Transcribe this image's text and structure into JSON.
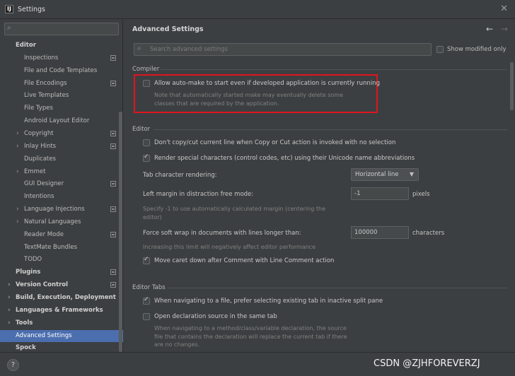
{
  "window": {
    "title": "Settings",
    "app_icon_text": "IJ"
  },
  "sidebar": {
    "search_placeholder": "",
    "items": [
      {
        "label": "Editor",
        "bold": true,
        "caret": "",
        "mark": false
      },
      {
        "label": "Inspections",
        "mark": true
      },
      {
        "label": "File and Code Templates",
        "mark": false
      },
      {
        "label": "File Encodings",
        "mark": true
      },
      {
        "label": "Live Templates",
        "mark": false
      },
      {
        "label": "File Types",
        "mark": false
      },
      {
        "label": "Android Layout Editor",
        "mark": false
      },
      {
        "label": "Copyright",
        "caret": ">",
        "mark": true
      },
      {
        "label": "Inlay Hints",
        "caret": ">",
        "mark": true
      },
      {
        "label": "Duplicates",
        "mark": false
      },
      {
        "label": "Emmet",
        "caret": ">",
        "mark": false
      },
      {
        "label": "GUI Designer",
        "mark": true
      },
      {
        "label": "Intentions",
        "mark": false
      },
      {
        "label": "Language Injections",
        "caret": ">",
        "mark": true
      },
      {
        "label": "Natural Languages",
        "caret": ">",
        "mark": false
      },
      {
        "label": "Reader Mode",
        "mark": true
      },
      {
        "label": "TextMate Bundles",
        "mark": false
      },
      {
        "label": "TODO",
        "mark": false
      },
      {
        "label": "Plugins",
        "bold": true,
        "mark": true
      },
      {
        "label": "Version Control",
        "bold": true,
        "caret": ">",
        "mark": true
      },
      {
        "label": "Build, Execution, Deployment",
        "bold": true,
        "caret": ">",
        "mark": false
      },
      {
        "label": "Languages & Frameworks",
        "bold": true,
        "caret": ">",
        "mark": false
      },
      {
        "label": "Tools",
        "bold": true,
        "caret": ">",
        "mark": false
      },
      {
        "label": "Advanced Settings",
        "bold": false,
        "selected": true,
        "mark": false
      },
      {
        "label": "Spock",
        "bold": true,
        "mark": false
      }
    ]
  },
  "main": {
    "title": "Advanced Settings",
    "search_placeholder": "Search advanced settings",
    "show_modified_only": "Show modified only",
    "compiler": {
      "heading": "Compiler",
      "auto_make_label": "Allow auto-make to start even if developed application is currently running",
      "auto_make_checked": false,
      "auto_make_note_1": "Note that automatically started make may eventually delete some",
      "auto_make_note_2": "classes that are required by the application."
    },
    "editor": {
      "heading": "Editor",
      "dont_copy_label": "Don't copy/cut current line when Copy or Cut action is invoked with no selection",
      "dont_copy_checked": false,
      "render_special_label": "Render special characters (control codes, etc) using their Unicode name abbreviations",
      "render_special_checked": true,
      "tab_rendering_label": "Tab character rendering:",
      "tab_rendering_value": "Horizontal line",
      "left_margin_label": "Left margin in distraction free mode:",
      "left_margin_value": "-1",
      "left_margin_unit": "pixels",
      "left_margin_note_1": "Specify -1 to use automatically calculated margin (centering the",
      "left_margin_note_2": "editor)",
      "soft_wrap_label": "Force soft wrap in documents with lines longer than:",
      "soft_wrap_value": "100000",
      "soft_wrap_unit": "characters",
      "soft_wrap_note": "Increasing this limit will negatively affect editor performance",
      "move_caret_label": "Move caret down after Comment with Line Comment action",
      "move_caret_checked": true
    },
    "editor_tabs": {
      "heading": "Editor Tabs",
      "prefer_existing_label": "When navigating to a file, prefer selecting existing tab in inactive split pane",
      "prefer_existing_checked": true,
      "open_decl_label": "Open declaration source in the same tab",
      "open_decl_checked": false,
      "open_decl_note_1": "When navigating to a method/class/variable declaration, the source",
      "open_decl_note_2": "file that contains the declaration will replace the current tab if there",
      "open_decl_note_3": "are no changes."
    }
  },
  "footer": {
    "help": "?",
    "watermark": "CSDN @ZJHFOREVERZJ"
  },
  "colors": {
    "selection": "#4b6eaf",
    "highlight_box": "#e0141e",
    "background": "#3c3f41"
  }
}
